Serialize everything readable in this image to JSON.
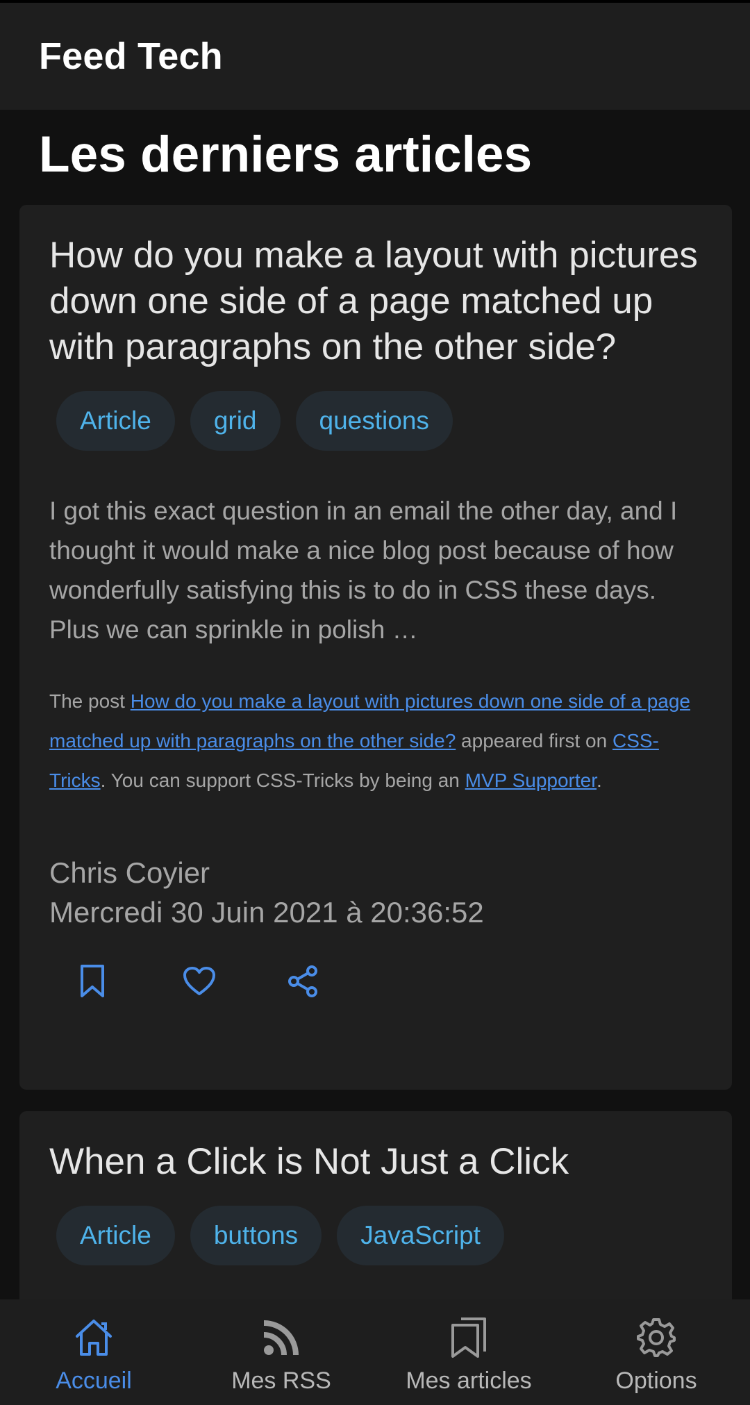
{
  "app": {
    "title": "Feed Tech"
  },
  "page": {
    "heading": "Les derniers articles"
  },
  "articles": [
    {
      "title": "How do you make a layout with pictures down one side of a page matched up with paragraphs on the other side?",
      "tags": [
        "Article",
        "grid",
        "questions"
      ],
      "excerpt": "I got this exact question in an email the other day, and I thought it would make a nice blog post because of how wonderfully satisfying this is to do in CSS these days. Plus we can sprinkle in polish …",
      "note": {
        "prefix": "The post ",
        "link_title": "How do you make a layout with pictures down one side of a page matched up with paragraphs on the other side?",
        "middle": " appeared first on ",
        "link_site": "CSS-Tricks",
        "suffix": ". You can support CSS-Tricks by being an ",
        "link_mvp": "MVP Supporter",
        "end": "."
      },
      "author": "Chris Coyier",
      "date": "Mercredi 30 Juin 2021 à 20:36:52"
    },
    {
      "title": "When a Click is Not Just a Click",
      "tags": [
        "Article",
        "buttons",
        "JavaScript"
      ]
    }
  ],
  "bottom_nav": [
    {
      "label": "Accueil",
      "icon": "home-icon",
      "active": true
    },
    {
      "label": "Mes RSS",
      "icon": "rss-icon",
      "active": false
    },
    {
      "label": "Mes articles",
      "icon": "bookmarks-icon",
      "active": false
    },
    {
      "label": "Options",
      "icon": "gear-icon",
      "active": false
    }
  ],
  "colors": {
    "accent": "#4a8de8",
    "tag_text": "#4fb3ea",
    "tag_bg": "#242b31",
    "card_bg": "#1f1f1f",
    "bar_bg": "#1e1e1e",
    "page_bg": "#111111"
  }
}
